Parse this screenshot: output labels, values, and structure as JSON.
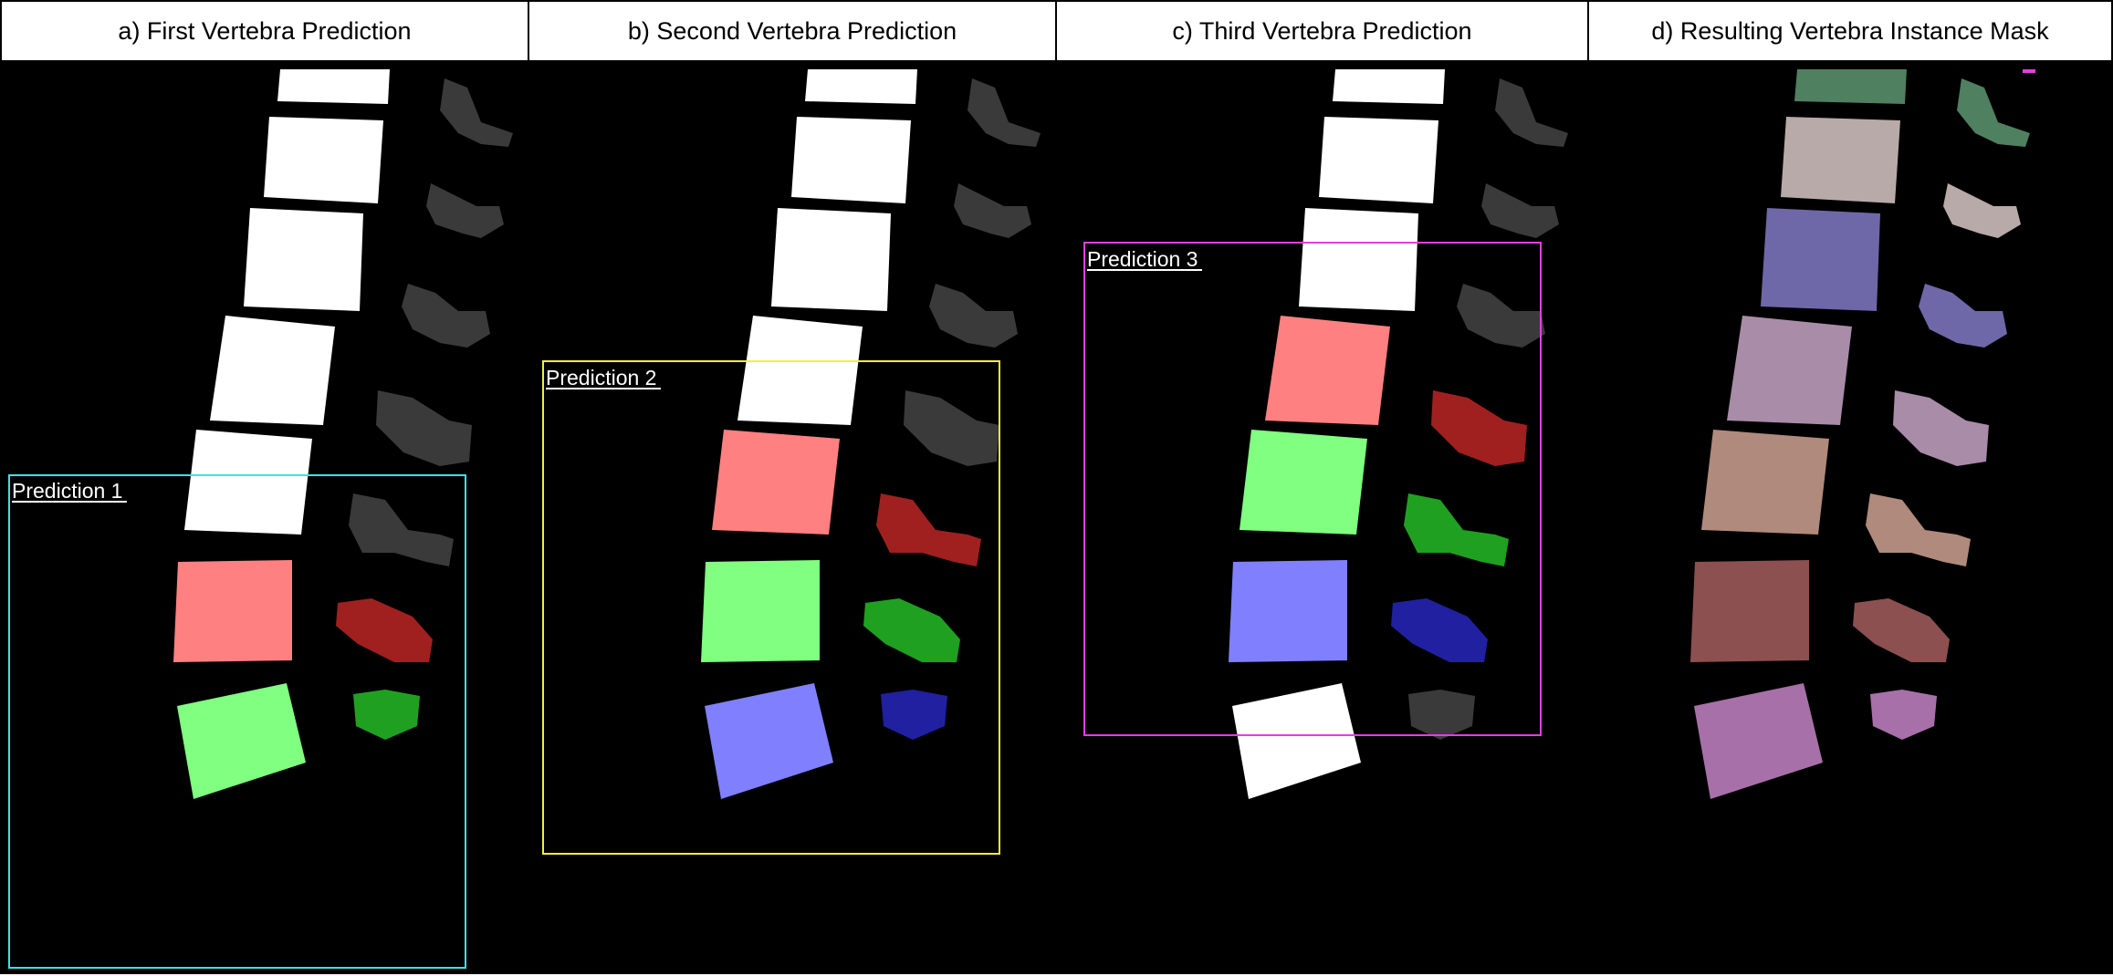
{
  "panels": [
    {
      "title": "a)  First Vertebra Prediction",
      "prediction_label": "Prediction 1",
      "box_color": "#40e0e0"
    },
    {
      "title": "b)  Second Vertebra Prediction",
      "prediction_label": "Prediction 2",
      "box_color": "#f0f040"
    },
    {
      "title": "c)  Third Vertebra Prediction",
      "prediction_label": "Prediction 3",
      "box_color": "#e040e0"
    },
    {
      "title": "d)  Resulting Vertebra Instance Mask"
    }
  ],
  "colors": {
    "unpredicted_body": "#ffffff",
    "unpredicted_process": "#3a3a3a",
    "pred_red": "#ff8080",
    "pred_red_process": "#a02020",
    "pred_green": "#80ff80",
    "pred_green_process": "#20a020",
    "pred_blue": "#8080ff",
    "pred_blue_process": "#2020a0",
    "instance_palette": [
      "#4f8060",
      "#b8aaa8",
      "#6e68a8",
      "#a88ca8",
      "#b08a7c",
      "#8c5050",
      "#a870a8"
    ]
  }
}
